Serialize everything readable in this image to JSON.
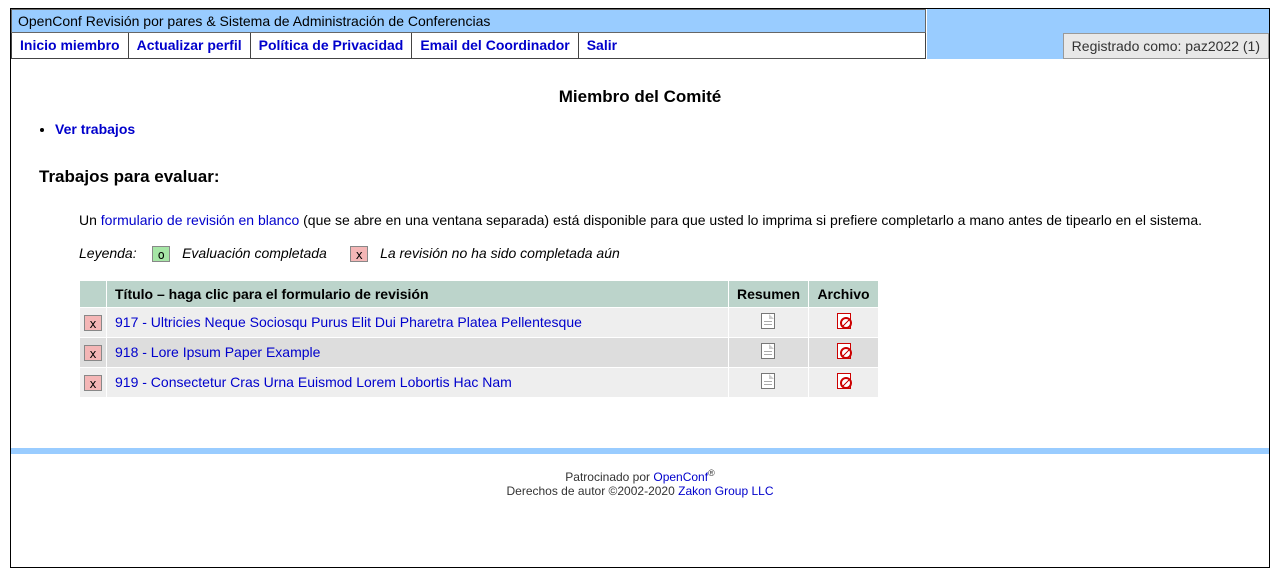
{
  "title_bar": "OpenConf Revisión por pares & Sistema de Administración de Conferencias",
  "nav": {
    "home": "Inicio miembro",
    "profile": "Actualizar perfil",
    "privacy": "Política de Privacidad",
    "email": "Email del Coordinador",
    "exit": "Salir"
  },
  "logged_in": "Registrado como: paz2022 (1)",
  "page_title": "Miembro del Comité",
  "actions": {
    "view_papers": "Ver trabajos"
  },
  "section_heading": "Trabajos para evaluar:",
  "desc": {
    "prefix": "Un ",
    "link": "formulario de revisión en blanco",
    "suffix": " (que se abre en una ventana separada) está disponible para que usted lo imprima si prefiere completarlo a mano antes de tipearlo en el sistema."
  },
  "legend": {
    "label": "Leyenda:",
    "done_symbol": "o",
    "done_text": "Evaluación completada",
    "pending_symbol": "x",
    "pending_text": "La revisión no ha sido completada aún"
  },
  "table": {
    "headers": {
      "title": "Título – haga clic para el formulario de revisión",
      "abstract": "Resumen",
      "file": "Archivo"
    },
    "rows": [
      {
        "status": "x",
        "title": "917 - Ultricies Neque Sociosqu Purus Elit Dui Pharetra Platea Pellentesque"
      },
      {
        "status": "x",
        "title": "918 - Lore Ipsum Paper Example"
      },
      {
        "status": "x",
        "title": "919 - Consectetur Cras Urna Euismod Lorem Lobortis Hac Nam"
      }
    ]
  },
  "footer": {
    "sponsored_prefix": "Patrocinado por ",
    "sponsored_link": "OpenConf",
    "reg": "®",
    "copyright_prefix": "Derechos de autor ©2002-2020 ",
    "copyright_link": "Zakon Group LLC"
  }
}
